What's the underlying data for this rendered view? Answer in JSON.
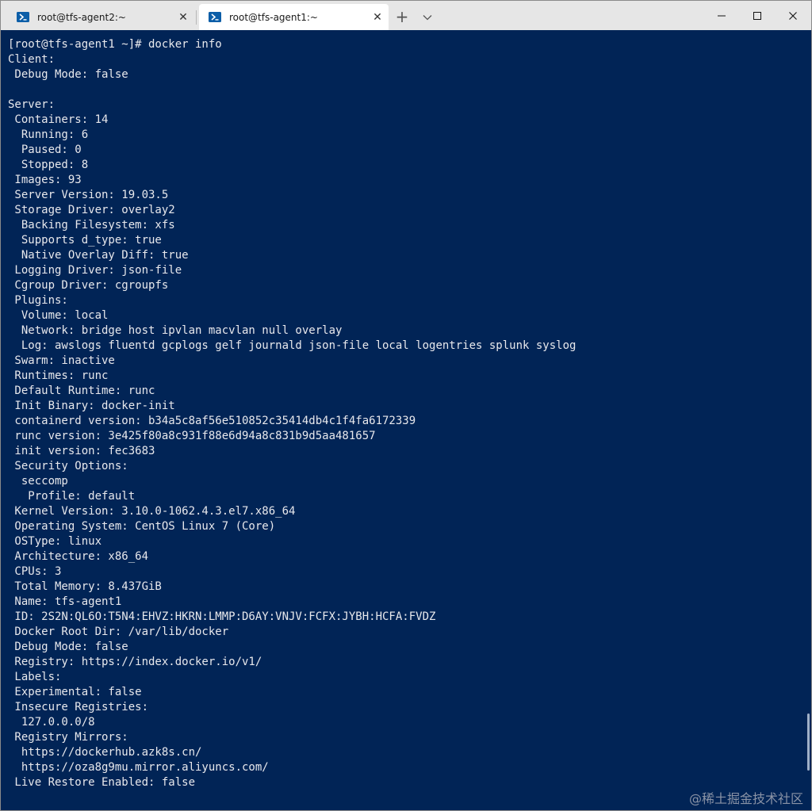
{
  "tabs": [
    {
      "title": "root@tfs-agent2:~",
      "close": "✕"
    },
    {
      "title": "root@tfs-agent1:~",
      "close": "✕"
    }
  ],
  "titlebar": {
    "new_tab": "+",
    "dropdown": "⌵",
    "minimize": "—",
    "maximize": "☐",
    "close": "✕"
  },
  "terminal": {
    "lines": [
      "[root@tfs-agent1 ~]# docker info",
      "Client:",
      " Debug Mode: false",
      "",
      "Server:",
      " Containers: 14",
      "  Running: 6",
      "  Paused: 0",
      "  Stopped: 8",
      " Images: 93",
      " Server Version: 19.03.5",
      " Storage Driver: overlay2",
      "  Backing Filesystem: xfs",
      "  Supports d_type: true",
      "  Native Overlay Diff: true",
      " Logging Driver: json-file",
      " Cgroup Driver: cgroupfs",
      " Plugins:",
      "  Volume: local",
      "  Network: bridge host ipvlan macvlan null overlay",
      "  Log: awslogs fluentd gcplogs gelf journald json-file local logentries splunk syslog",
      " Swarm: inactive",
      " Runtimes: runc",
      " Default Runtime: runc",
      " Init Binary: docker-init",
      " containerd version: b34a5c8af56e510852c35414db4c1f4fa6172339",
      " runc version: 3e425f80a8c931f88e6d94a8c831b9d5aa481657",
      " init version: fec3683",
      " Security Options:",
      "  seccomp",
      "   Profile: default",
      " Kernel Version: 3.10.0-1062.4.3.el7.x86_64",
      " Operating System: CentOS Linux 7 (Core)",
      " OSType: linux",
      " Architecture: x86_64",
      " CPUs: 3",
      " Total Memory: 8.437GiB",
      " Name: tfs-agent1",
      " ID: 2S2N:QL6O:T5N4:EHVZ:HKRN:LMMP:D6AY:VNJV:FCFX:JYBH:HCFA:FVDZ",
      " Docker Root Dir: /var/lib/docker",
      " Debug Mode: false",
      " Registry: https://index.docker.io/v1/",
      " Labels:",
      " Experimental: false",
      " Insecure Registries:",
      "  127.0.0.0/8",
      " Registry Mirrors:",
      "  https://dockerhub.azk8s.cn/",
      "  https://oza8g9mu.mirror.aliyuncs.com/",
      " Live Restore Enabled: false"
    ]
  },
  "watermark": "@稀土掘金技术社区",
  "colors": {
    "terminal_bg": "#012456",
    "terminal_fg": "#e8e8ec",
    "tab_icon": "#0c5ea8"
  }
}
